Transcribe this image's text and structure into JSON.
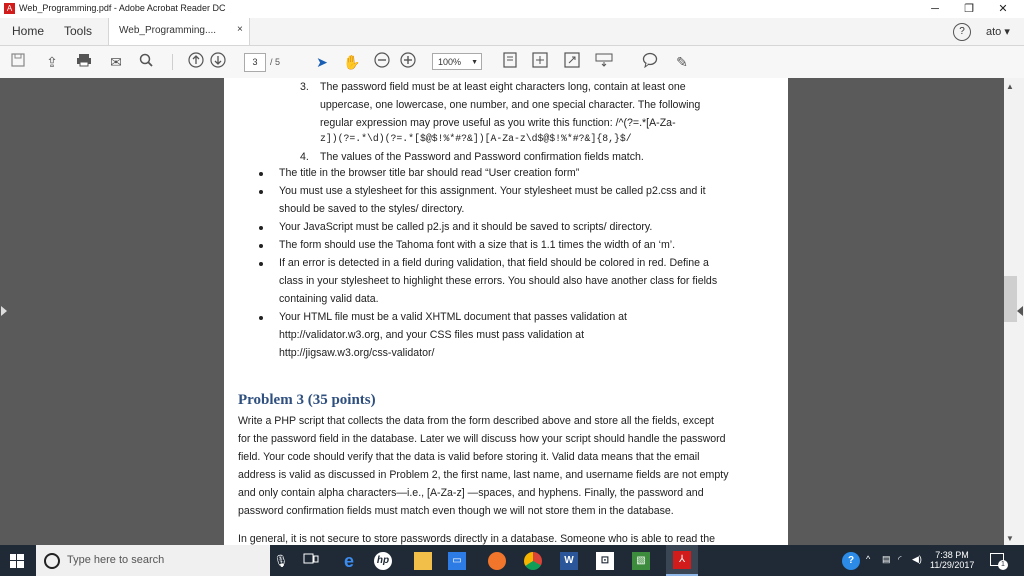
{
  "window": {
    "title": "Web_Programming.pdf - Adobe Acrobat Reader DC",
    "app_icon": "acrobat-icon"
  },
  "menubar": {
    "home": "Home",
    "tools": "Tools",
    "tab_label": "Web_Programming....",
    "tab_close": "×",
    "help": "?",
    "account": "ato"
  },
  "toolbar": {
    "page_current": "3",
    "page_total": "/ 5",
    "zoom": "100%"
  },
  "document": {
    "item3_num": "3.",
    "item3_lines": [
      "The password field must be at least eight characters long, contain at least one",
      "uppercase, one lowercase, one number, and one special character. The following",
      "regular expression may prove useful as you write this function: /^(?=.*[A-Za-",
      "z])(?=.*\\d)(?=.*[$@$!%*#?&])[A-Za-z\\d$@$!%*#?&]{8,}$/"
    ],
    "item4_num": "4.",
    "item4": "The values of the Password and Password confirmation fields match.",
    "bullets": [
      {
        "lines": [
          "The title in the browser title bar should read “User creation form”"
        ]
      },
      {
        "lines": [
          "You must use a stylesheet for this assignment. Your stylesheet must be called p2.css and it",
          "should be saved to the styles/ directory."
        ]
      },
      {
        "lines": [
          "Your JavaScript must be called p2.js and it should be saved to scripts/ directory."
        ]
      },
      {
        "lines": [
          "The form should use the Tahoma font with a size that is 1.1 times the width of an ‘m’."
        ]
      },
      {
        "lines": [
          "If an error is detected in a field during validation, that field should be colored in red. Define a",
          "class in your stylesheet to highlight these errors. You should also have another class for fields",
          "containing valid data."
        ]
      },
      {
        "lines": [
          "Your HTML file must be a valid XHTML document that passes validation at",
          "http://validator.w3.org, and your CSS files must pass validation at",
          "http://jigsaw.w3.org/css-validator/"
        ]
      }
    ],
    "problem3_heading": "Problem 3 (35 points)",
    "problem3_lines": [
      "Write a PHP script that collects the data from the form described above and store all the fields, except",
      "for the password field in the database. Later we will discuss how your script should handle the password",
      "field. Your code should verify that the data is valid before storing it. Valid data means that the email",
      "address is valid as discussed in Problem 2, the first name, last name, and username fields are not empty",
      "and only contain alpha characters—i.e., [A-Za-z] —spaces, and hyphens. Finally, the password and",
      "password confirmation fields must match even though we will not store them in the database."
    ],
    "last_line": "In general, it is not secure to store passwords directly in a database. Someone who is able to read the"
  },
  "taskbar": {
    "search_placeholder": "Type here to search",
    "time": "7:38 PM",
    "date": "11/29/2017",
    "notif_count": "1"
  }
}
